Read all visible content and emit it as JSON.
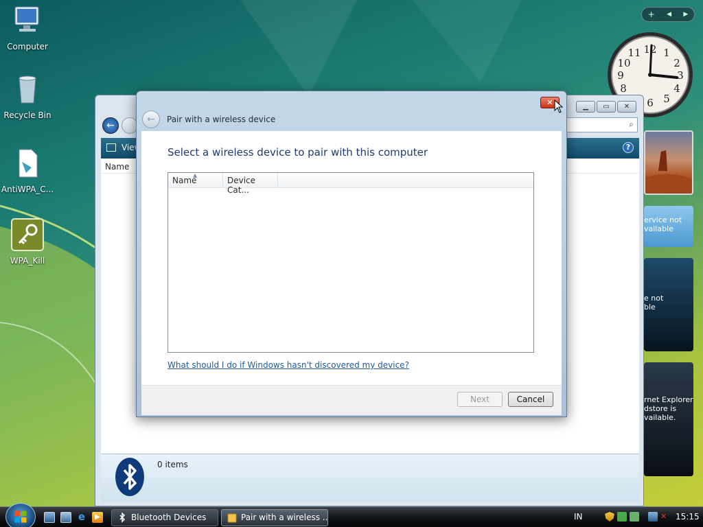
{
  "desktop": {
    "icons": [
      {
        "label": "Computer"
      },
      {
        "label": "Recycle Bin"
      },
      {
        "label": "AntiWPA_C..."
      },
      {
        "label": "WPA_Kill"
      }
    ]
  },
  "gadgets": {
    "controls": [
      "+",
      "◀",
      "▶"
    ],
    "clock_numbers": [
      "12",
      "1",
      "2",
      "3",
      "4",
      "5",
      "6",
      "7",
      "8",
      "9",
      "10",
      "11"
    ],
    "feed1_text": [
      "ervice not",
      "vailable"
    ],
    "feed2_text": [
      "e not",
      "ble"
    ],
    "feed3_text": [
      "rnet Explorer",
      "dstore is",
      "vailable."
    ]
  },
  "explorer": {
    "toolbar_label": "View",
    "column_header": "Name",
    "status_count": "0 items"
  },
  "dialog": {
    "title": "Pair with a wireless device",
    "heading": "Select a wireless device to pair with this computer",
    "columns": [
      "Name",
      "Device Cat..."
    ],
    "help_link": "What should I do if Windows hasn't discovered my device?",
    "next_label": "Next",
    "cancel_label": "Cancel",
    "close_glyph": "✕"
  },
  "taskbar": {
    "tasks": [
      {
        "label": "Bluetooth Devices"
      },
      {
        "label": "Pair with a wireless ..."
      }
    ],
    "language": "IN",
    "time": "15:15"
  },
  "colors": {
    "accent": "#1e3a6e",
    "link": "#1e5a9a",
    "close_red": "#c63218"
  }
}
